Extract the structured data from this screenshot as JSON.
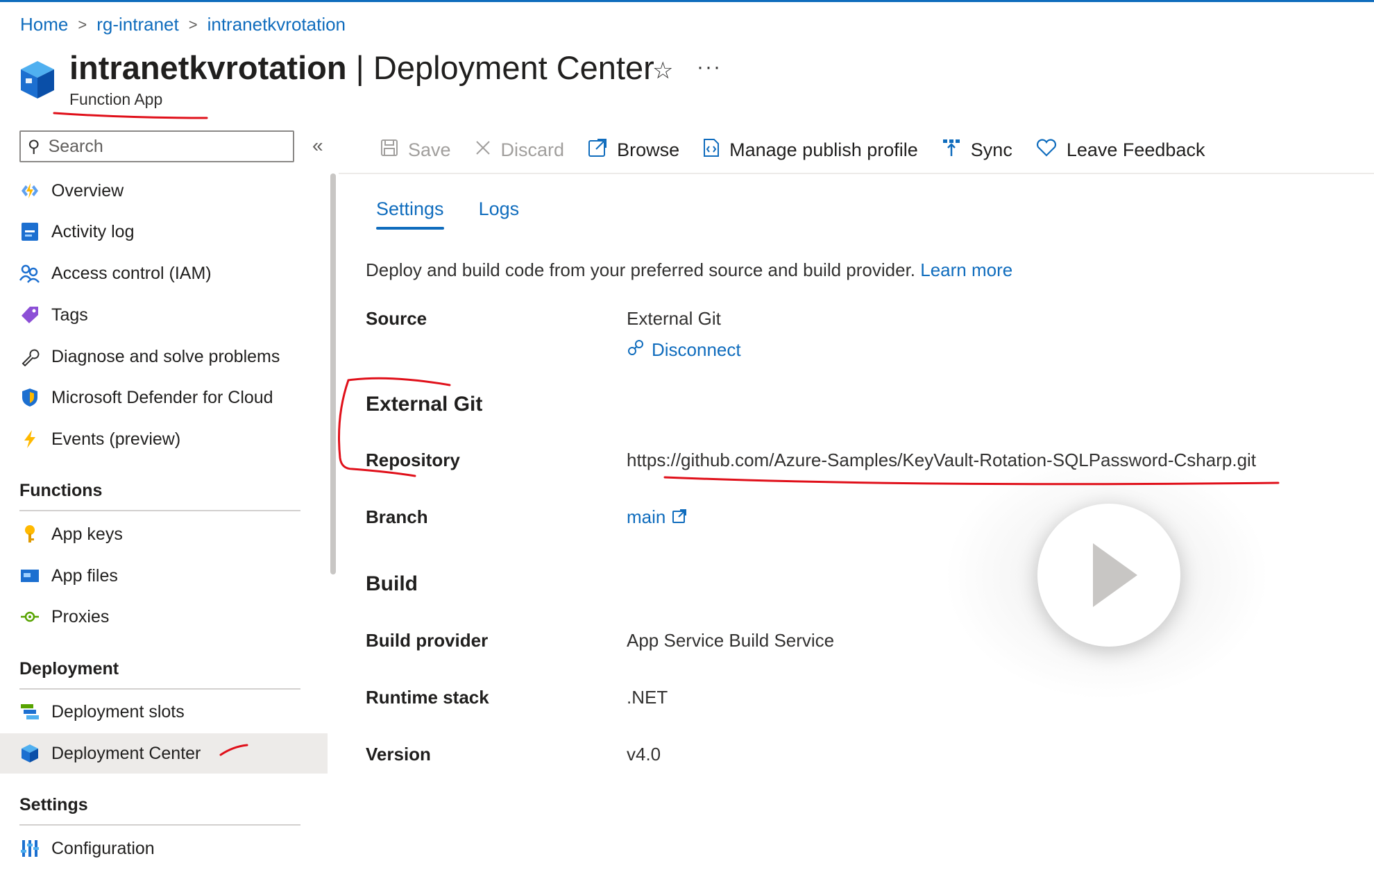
{
  "breadcrumb": {
    "home": "Home",
    "resource_group": "rg-intranet",
    "resource": "intranetkvrotation"
  },
  "header": {
    "title_bold": "intranetkvrotation",
    "title_rest": "| Deployment Center",
    "subtitle": "Function App",
    "star_glyph": "☆",
    "more_glyph": "···"
  },
  "sidebar": {
    "search_placeholder": "Search",
    "collapse_glyph": "«",
    "items": [
      {
        "label": "Overview",
        "icon": "function-bolt-icon"
      },
      {
        "label": "Activity log",
        "icon": "activity-log-icon"
      },
      {
        "label": "Access control (IAM)",
        "icon": "people-icon"
      },
      {
        "label": "Tags",
        "icon": "tag-icon"
      },
      {
        "label": "Diagnose and solve problems",
        "icon": "wrench-icon"
      },
      {
        "label": "Microsoft Defender for Cloud",
        "icon": "shield-icon"
      },
      {
        "label": "Events (preview)",
        "icon": "lightning-icon"
      }
    ],
    "sections": {
      "functions": {
        "title": "Functions",
        "items": [
          {
            "label": "App keys",
            "icon": "key-icon"
          },
          {
            "label": "App files",
            "icon": "app-files-icon"
          },
          {
            "label": "Proxies",
            "icon": "proxy-icon"
          }
        ]
      },
      "deployment": {
        "title": "Deployment",
        "items": [
          {
            "label": "Deployment slots",
            "icon": "slots-icon"
          },
          {
            "label": "Deployment Center",
            "icon": "cube-icon",
            "active": true
          }
        ]
      },
      "settings": {
        "title": "Settings",
        "items": [
          {
            "label": "Configuration",
            "icon": "sliders-icon"
          }
        ]
      }
    }
  },
  "toolbar": {
    "save": "Save",
    "discard": "Discard",
    "browse": "Browse",
    "manage_publish_profile": "Manage publish profile",
    "sync": "Sync",
    "leave_feedback": "Leave Feedback"
  },
  "tabs": {
    "settings": "Settings",
    "logs": "Logs"
  },
  "content": {
    "description": "Deploy and build code from your preferred source and build provider.",
    "learn_more": "Learn more",
    "source_label": "Source",
    "source_value": "External Git",
    "disconnect": "Disconnect",
    "external_git_heading": "External Git",
    "repository_label": "Repository",
    "repository_value": "https://github.com/Azure-Samples/KeyVault-Rotation-SQLPassword-Csharp.git",
    "branch_label": "Branch",
    "branch_value": "main",
    "build_heading": "Build",
    "build_provider_label": "Build provider",
    "build_provider_value": "App Service Build Service",
    "runtime_stack_label": "Runtime stack",
    "runtime_stack_value": ".NET",
    "version_label": "Version",
    "version_value": "v4.0"
  },
  "colors": {
    "accent": "#0f6cbd",
    "annotation": "#e0101a",
    "active_nav": "#edebe9"
  }
}
